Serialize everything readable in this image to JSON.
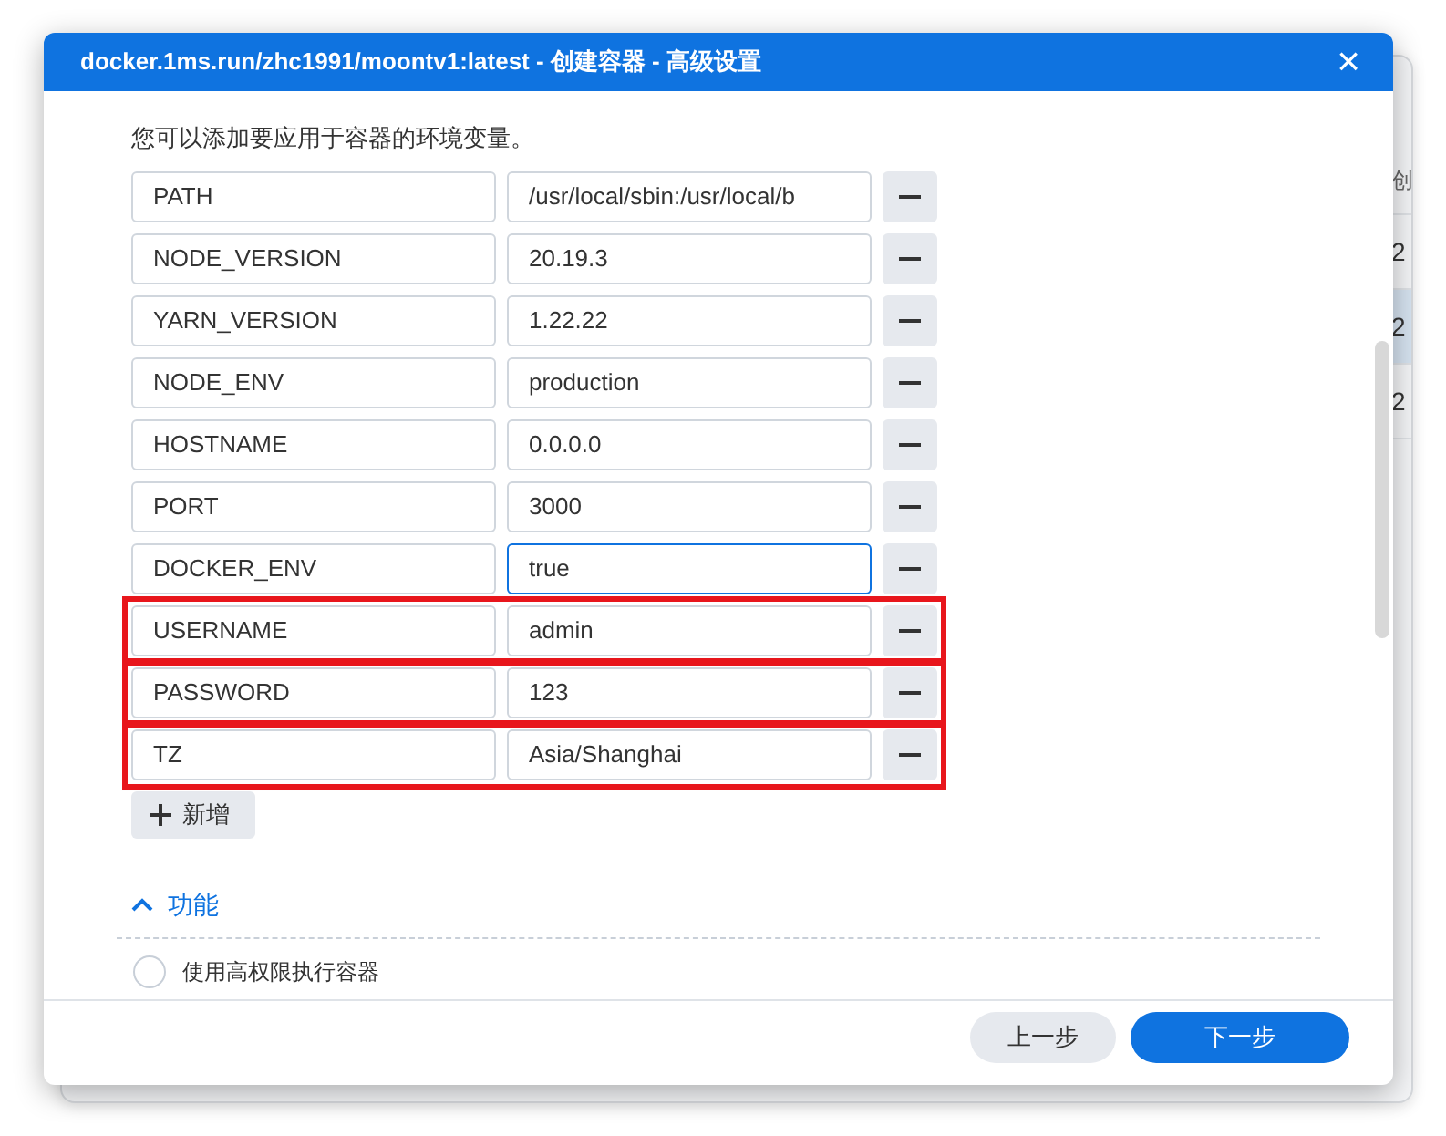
{
  "background_window": {
    "column_header": "创",
    "rows": [
      {
        "cell": "2",
        "selected": false
      },
      {
        "cell": "2",
        "selected": true
      },
      {
        "cell": "2",
        "selected": false
      }
    ]
  },
  "dialog": {
    "title": "docker.1ms.run/zhc1991/moontv1:latest - 创建容器 - 高级设置",
    "close": "×",
    "intro": "您可以添加要应用于容器的环境变量。",
    "env_vars": [
      {
        "name": "PATH",
        "value": "/usr/local/sbin:/usr/local/b",
        "focused": false,
        "highlighted": false
      },
      {
        "name": "NODE_VERSION",
        "value": "20.19.3",
        "focused": false,
        "highlighted": false
      },
      {
        "name": "YARN_VERSION",
        "value": "1.22.22",
        "focused": false,
        "highlighted": false
      },
      {
        "name": "NODE_ENV",
        "value": "production",
        "focused": false,
        "highlighted": false
      },
      {
        "name": "HOSTNAME",
        "value": "0.0.0.0",
        "focused": false,
        "highlighted": false
      },
      {
        "name": "PORT",
        "value": "3000",
        "focused": false,
        "highlighted": false
      },
      {
        "name": "DOCKER_ENV",
        "value": "true",
        "focused": true,
        "highlighted": false
      },
      {
        "name": "USERNAME",
        "value": "admin",
        "focused": false,
        "highlighted": true
      },
      {
        "name": "PASSWORD",
        "value": "123",
        "focused": false,
        "highlighted": true
      },
      {
        "name": "TZ",
        "value": "Asia/Shanghai",
        "focused": false,
        "highlighted": true
      }
    ],
    "add_button": "新增",
    "section": {
      "title": "功能",
      "expanded": true,
      "options": [
        {
          "label": "使用高权限执行容器",
          "checked": false
        }
      ]
    },
    "buttons": [
      {
        "label": "上一步",
        "kind": "secondary"
      },
      {
        "label": "下一步",
        "kind": "primary"
      }
    ]
  }
}
